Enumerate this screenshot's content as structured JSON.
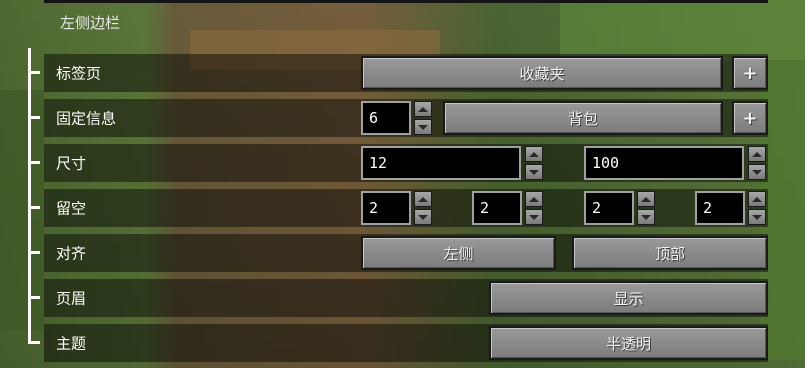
{
  "section_title": "左侧边栏",
  "rows": [
    {
      "label": "标签页"
    },
    {
      "label": "固定信息"
    },
    {
      "label": "尺寸"
    },
    {
      "label": "留空"
    },
    {
      "label": "对齐"
    },
    {
      "label": "页眉"
    },
    {
      "label": "主题"
    }
  ],
  "tabs": {
    "button_label": "收藏夹",
    "add_label": "+"
  },
  "pinned": {
    "value": "6",
    "button_label": "背包",
    "add_label": "+"
  },
  "size": {
    "width": "12",
    "height": "100"
  },
  "padding": {
    "values": [
      "2",
      "2",
      "2",
      "2"
    ]
  },
  "align": {
    "horizontal": "左侧",
    "vertical": "顶部"
  },
  "header": {
    "value": "显示"
  },
  "theme": {
    "value": "半透明"
  }
}
